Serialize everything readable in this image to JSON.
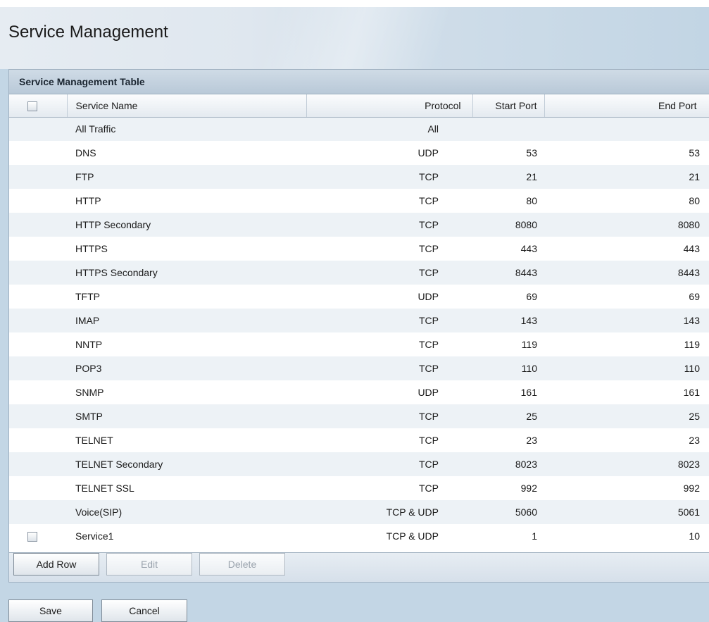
{
  "page": {
    "title": "Service Management"
  },
  "table": {
    "title": "Service Management Table",
    "columns": {
      "name": "Service Name",
      "protocol": "Protocol",
      "start": "Start Port",
      "end": "End Port"
    },
    "rows": [
      {
        "name": "All Traffic",
        "protocol": "All",
        "start": "",
        "end": "",
        "checkbox": false
      },
      {
        "name": "DNS",
        "protocol": "UDP",
        "start": "53",
        "end": "53",
        "checkbox": false
      },
      {
        "name": "FTP",
        "protocol": "TCP",
        "start": "21",
        "end": "21",
        "checkbox": false
      },
      {
        "name": "HTTP",
        "protocol": "TCP",
        "start": "80",
        "end": "80",
        "checkbox": false
      },
      {
        "name": "HTTP Secondary",
        "protocol": "TCP",
        "start": "8080",
        "end": "8080",
        "checkbox": false
      },
      {
        "name": "HTTPS",
        "protocol": "TCP",
        "start": "443",
        "end": "443",
        "checkbox": false
      },
      {
        "name": "HTTPS Secondary",
        "protocol": "TCP",
        "start": "8443",
        "end": "8443",
        "checkbox": false
      },
      {
        "name": "TFTP",
        "protocol": "UDP",
        "start": "69",
        "end": "69",
        "checkbox": false
      },
      {
        "name": "IMAP",
        "protocol": "TCP",
        "start": "143",
        "end": "143",
        "checkbox": false
      },
      {
        "name": "NNTP",
        "protocol": "TCP",
        "start": "119",
        "end": "119",
        "checkbox": false
      },
      {
        "name": "POP3",
        "protocol": "TCP",
        "start": "110",
        "end": "110",
        "checkbox": false
      },
      {
        "name": "SNMP",
        "protocol": "UDP",
        "start": "161",
        "end": "161",
        "checkbox": false
      },
      {
        "name": "SMTP",
        "protocol": "TCP",
        "start": "25",
        "end": "25",
        "checkbox": false
      },
      {
        "name": "TELNET",
        "protocol": "TCP",
        "start": "23",
        "end": "23",
        "checkbox": false
      },
      {
        "name": "TELNET Secondary",
        "protocol": "TCP",
        "start": "8023",
        "end": "8023",
        "checkbox": false
      },
      {
        "name": "TELNET SSL",
        "protocol": "TCP",
        "start": "992",
        "end": "992",
        "checkbox": false
      },
      {
        "name": "Voice(SIP)",
        "protocol": "TCP & UDP",
        "start": "5060",
        "end": "5061",
        "checkbox": false
      },
      {
        "name": "Service1",
        "protocol": "TCP & UDP",
        "start": "1",
        "end": "10",
        "checkbox": true
      }
    ]
  },
  "toolbar": {
    "add_row": "Add Row",
    "edit": "Edit",
    "delete": "Delete"
  },
  "actions": {
    "save": "Save",
    "cancel": "Cancel"
  },
  "colors": {
    "accent_bg": "#c3d6e5",
    "alt_row": "#edf2f6"
  }
}
